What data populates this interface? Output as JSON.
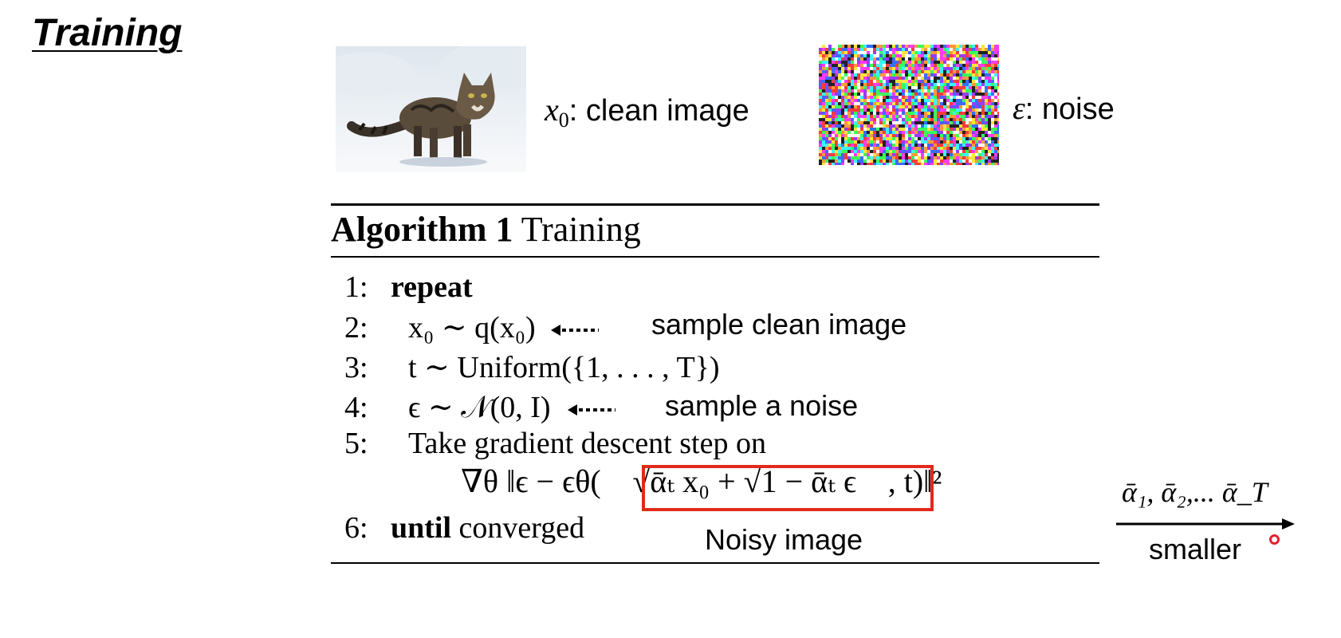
{
  "slide": {
    "title": "Training"
  },
  "captions": {
    "clean_var": "x",
    "clean_sub": "0",
    "clean_text": ": clean image",
    "noise_var": "ε",
    "noise_text": ": noise"
  },
  "algorithm": {
    "header_bold": "Algorithm 1",
    "header_text": "Training",
    "lines": {
      "l1_num": "1:",
      "l1_kw": "repeat",
      "l2_num": "2:",
      "l2_math": "x₀ ∼ q(x₀)",
      "l3_num": "3:",
      "l3_math": "t ∼ Uniform({1, . . . , T})",
      "l4_num": "4:",
      "l4_math": "ϵ ∼ 𝒩(0, I)",
      "l5_num": "5:",
      "l5_text": "Take gradient descent step on",
      "formula_left": "∇θ ‖ϵ − ϵθ(",
      "formula_box": "√ᾱₜ x₀ + √1 − ᾱₜ ϵ",
      "formula_right": ", t)‖²",
      "l6_num": "6:",
      "l6_kw": "until",
      "l6_text": "converged"
    }
  },
  "annotations": {
    "sample_clean": "sample clean image",
    "sample_noise": "sample a noise",
    "noisy_image": "Noisy image",
    "alpha_sequence": "ᾱ₁, ᾱ₂,... ᾱ_T",
    "smaller": "smaller"
  },
  "colors": {
    "highlight_box": "#e02a1c",
    "pointer": "#e0242e"
  },
  "icons": {
    "cat": "cat-photo",
    "noise": "noise-image",
    "arrow": "dotted-left-arrow"
  }
}
